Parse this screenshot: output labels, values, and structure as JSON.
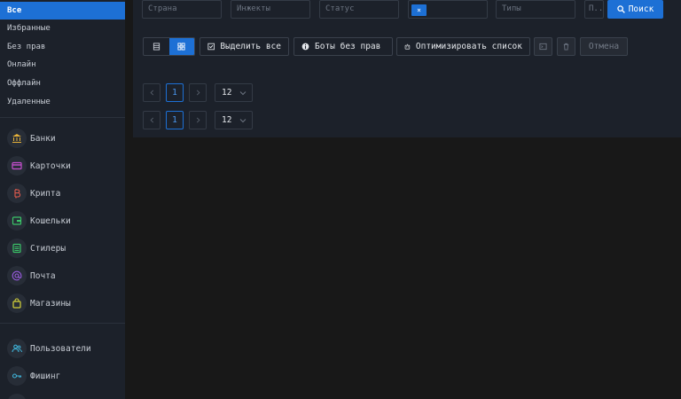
{
  "sidebar": {
    "filters": [
      {
        "label": "Все",
        "active": true
      },
      {
        "label": "Избранные",
        "active": false
      },
      {
        "label": "Без прав",
        "active": false
      },
      {
        "label": "Онлайн",
        "active": false
      },
      {
        "label": "Оффлайн",
        "active": false
      },
      {
        "label": "Удаленные",
        "active": false
      }
    ],
    "nav": [
      {
        "label": "Банки",
        "icon": "bank-icon",
        "color": "#e8b33a"
      },
      {
        "label": "Карточки",
        "icon": "card-icon",
        "color": "#c64fcf"
      },
      {
        "label": "Крипта",
        "icon": "bitcoin-icon",
        "color": "#e05a4e"
      },
      {
        "label": "Кошельки",
        "icon": "wallet-icon",
        "color": "#3bc468"
      },
      {
        "label": "Стилеры",
        "icon": "stealer-icon",
        "color": "#3bc468"
      },
      {
        "label": "Почта",
        "icon": "at-icon",
        "color": "#9a5be0"
      },
      {
        "label": "Магазины",
        "icon": "shopping-bag-icon",
        "color": "#d6d43a"
      },
      {
        "label": "Пользователи",
        "icon": "users-icon",
        "color": "#3fb2d8"
      },
      {
        "label": "Фишинг",
        "icon": "key-icon",
        "color": "#3fb2d8"
      }
    ]
  },
  "filters_bar": {
    "country_placeholder": "Страна",
    "injects_placeholder": "Инжекты",
    "status_placeholder": "Статус",
    "chip_label": "×",
    "types_placeholder": "Типы",
    "extra_placeholder": "П...",
    "search_label": "Поиск"
  },
  "toolbar": {
    "select_all_label": "Выделить все",
    "bots_no_rights_label": "Боты без прав",
    "optimize_label": "Оптимизировать список",
    "cancel_label": "Отмена"
  },
  "pagination": [
    {
      "current_page": "1",
      "page_size": "12"
    },
    {
      "current_page": "1",
      "page_size": "12"
    }
  ],
  "colors": {
    "accent": "#1d70d5",
    "background": "#181818",
    "panel": "#1c212a"
  }
}
